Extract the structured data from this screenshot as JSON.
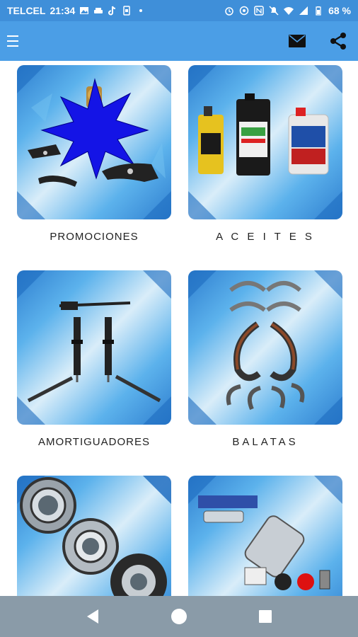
{
  "status_bar": {
    "carrier": "TELCEL",
    "time": "21:34",
    "battery": "68 %"
  },
  "app_bar": {
    "icons": [
      "menu-icon",
      "mail-icon",
      "share-icon"
    ]
  },
  "categories": [
    {
      "label": "PROMOCIONES",
      "icon": "promo-starburst"
    },
    {
      "label": "A C E I T E S",
      "icon": "oil-bottles"
    },
    {
      "label": "AMORTIGUADORES",
      "icon": "shock-absorbers"
    },
    {
      "label": "BALATAS",
      "icon": "brake-shoes"
    },
    {
      "label": "",
      "icon": "wheel-bearings"
    },
    {
      "label": "",
      "icon": "fuel-pump"
    }
  ],
  "nav": {
    "icons": [
      "back-icon",
      "home-icon",
      "recents-icon"
    ]
  },
  "colors": {
    "status_bar": "#3f8fd9",
    "app_bar": "#4b9ee6",
    "nav_bar": "#8a9ba8",
    "starburst": "#1414e6"
  }
}
